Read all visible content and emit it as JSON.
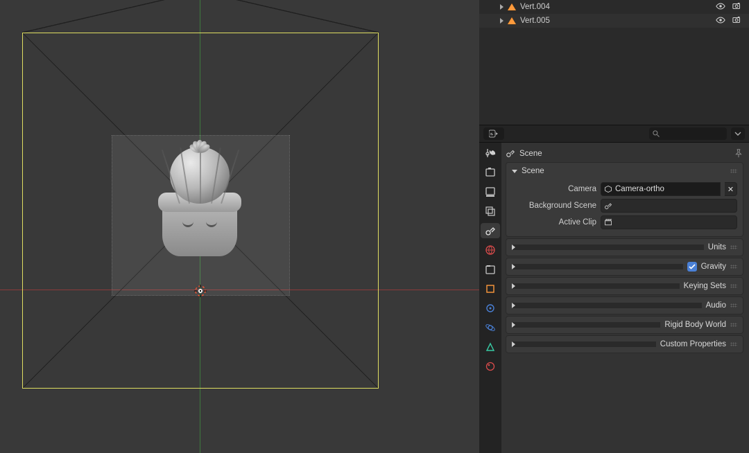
{
  "outliner": {
    "items": [
      {
        "name": "Vert.004"
      },
      {
        "name": "Vert.005"
      }
    ]
  },
  "properties_header": {
    "search_placeholder": ""
  },
  "breadcrumb": {
    "label": "Scene"
  },
  "scene_panel": {
    "title": "Scene",
    "camera_label": "Camera",
    "camera_value": "Camera-ortho",
    "bgscene_label": "Background Scene",
    "bgscene_value": "",
    "clip_label": "Active Clip",
    "clip_value": ""
  },
  "panels": [
    {
      "title": "Units"
    },
    {
      "title": "Gravity",
      "has_checkbox": true
    },
    {
      "title": "Keying Sets"
    },
    {
      "title": "Audio"
    },
    {
      "title": "Rigid Body World"
    },
    {
      "title": "Custom Properties"
    }
  ]
}
